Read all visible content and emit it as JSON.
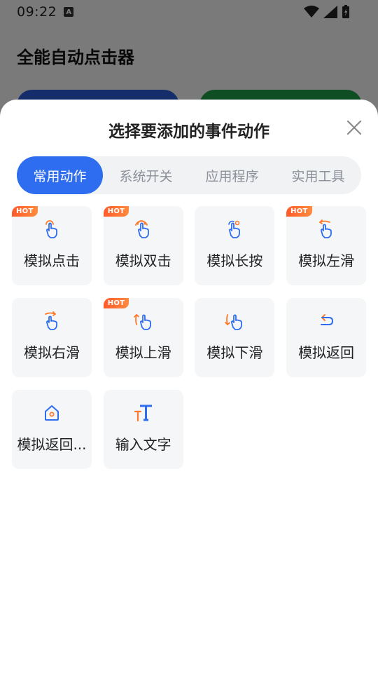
{
  "status_bar": {
    "time": "09:22",
    "indicator": "A"
  },
  "app": {
    "title": "全能自动点击器"
  },
  "sheet": {
    "title": "选择要添加的事件动作",
    "tabs": [
      {
        "label": "常用动作",
        "active": true
      },
      {
        "label": "系统开关",
        "active": false
      },
      {
        "label": "应用程序",
        "active": false
      },
      {
        "label": "实用工具",
        "active": false
      }
    ],
    "actions": [
      {
        "label": "模拟点击",
        "hot": true,
        "icon": "tap-hand-icon"
      },
      {
        "label": "模拟双击",
        "hot": true,
        "icon": "double-tap-hand-icon"
      },
      {
        "label": "模拟长按",
        "hot": false,
        "icon": "long-press-hand-icon"
      },
      {
        "label": "模拟左滑",
        "hot": true,
        "icon": "swipe-left-hand-icon"
      },
      {
        "label": "模拟右滑",
        "hot": false,
        "icon": "swipe-right-hand-icon"
      },
      {
        "label": "模拟上滑",
        "hot": true,
        "icon": "swipe-up-hand-icon"
      },
      {
        "label": "模拟下滑",
        "hot": false,
        "icon": "swipe-down-hand-icon"
      },
      {
        "label": "模拟返回",
        "hot": false,
        "icon": "back-arrow-icon"
      },
      {
        "label": "模拟返回...",
        "hot": false,
        "icon": "home-icon"
      },
      {
        "label": "输入文字",
        "hot": false,
        "icon": "text-input-icon"
      }
    ],
    "hot_label": "HOT"
  },
  "colors": {
    "accent": "#2f6df0",
    "orange": "#ff7a2c",
    "hot": "#ff5a2c"
  }
}
